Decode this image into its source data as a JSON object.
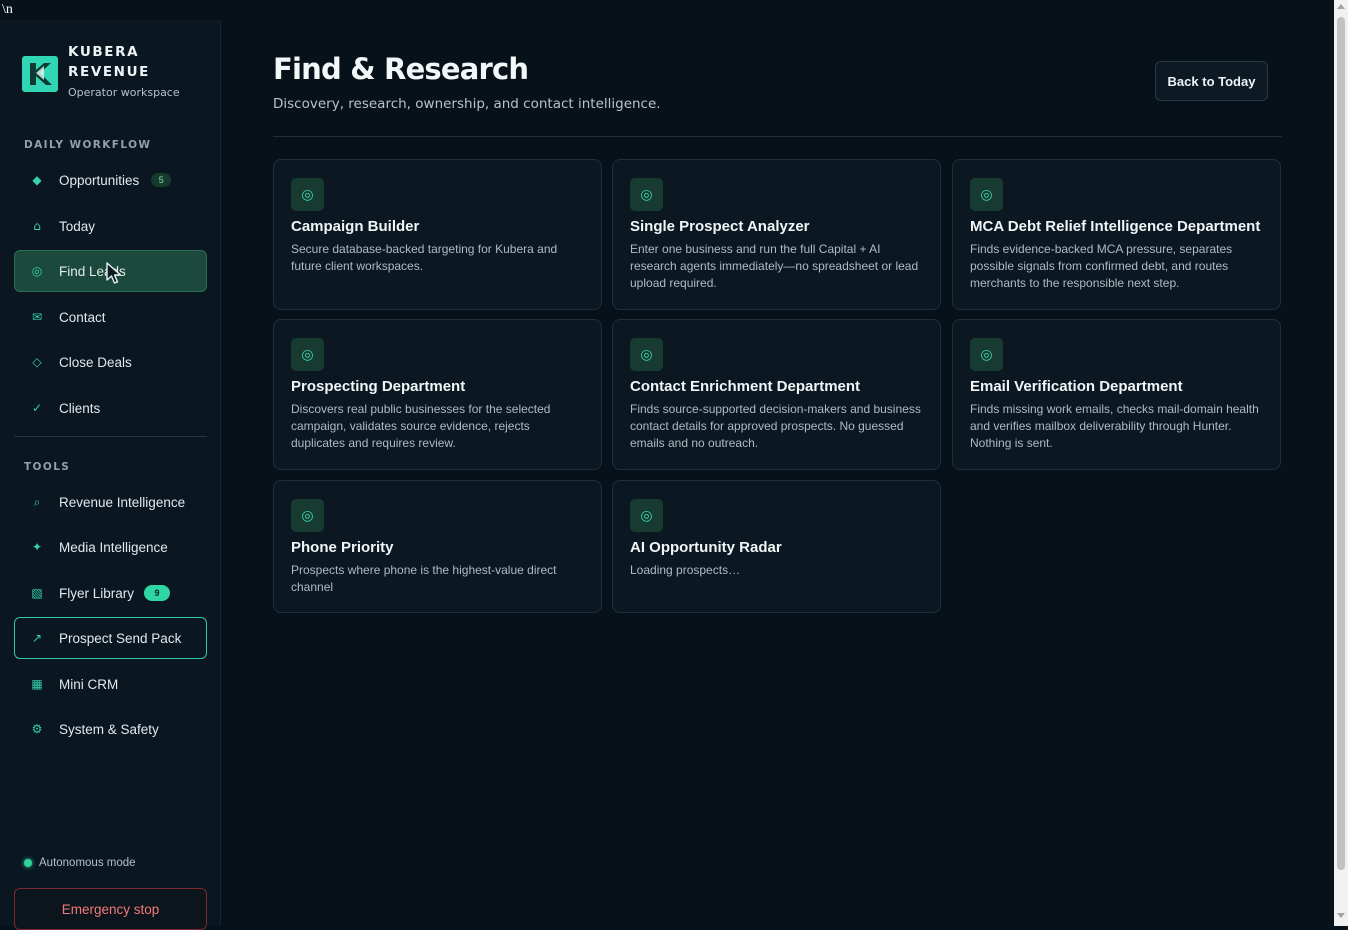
{
  "stray_text": "\\n",
  "brand": {
    "name": "KUBERA REVENUE",
    "subtitle": "Operator workspace",
    "logo_icon": "kubera-logo-icon"
  },
  "sidebar": {
    "daily_label": "DAILY WORKFLOW",
    "daily_items": [
      {
        "label": "Opportunities",
        "icon": "diamond-filled-icon",
        "badge": "5"
      },
      {
        "label": "Today",
        "icon": "home-icon"
      },
      {
        "label": "Find Leads",
        "icon": "target-icon",
        "active": true
      },
      {
        "label": "Contact",
        "icon": "mail-icon"
      },
      {
        "label": "Close Deals",
        "icon": "diamond-outline-icon"
      },
      {
        "label": "Clients",
        "icon": "check-icon"
      }
    ],
    "tools_label": "TOOLS",
    "tool_items": [
      {
        "label": "Revenue Intelligence",
        "icon": "search-icon"
      },
      {
        "label": "Media Intelligence",
        "icon": "sparkle-icon"
      },
      {
        "label": "Flyer Library",
        "icon": "image-icon",
        "badge": "9"
      },
      {
        "label": "Prospect Send Pack",
        "icon": "arrow-up-right-icon",
        "outlined": true
      },
      {
        "label": "Mini CRM",
        "icon": "grid-icon"
      },
      {
        "label": "System & Safety",
        "icon": "gear-icon"
      }
    ],
    "autonomous_label": "Autonomous mode",
    "emergency_label": "Emergency stop"
  },
  "header": {
    "title": "Find & Research",
    "subtitle": "Discovery, research, ownership, and contact intelligence.",
    "back_label": "Back to Today"
  },
  "cards": [
    {
      "title": "Campaign Builder",
      "desc": "Secure database-backed targeting for Kubera and future client workspaces."
    },
    {
      "title": "Single Prospect Analyzer",
      "desc": "Enter one business and run the full Capital + AI research agents immediately—no spreadsheet or lead upload required."
    },
    {
      "title": "MCA Debt Relief Intelligence Department",
      "desc": "Finds evidence-backed MCA pressure, separates possible signals from confirmed debt, and routes merchants to the responsible next step."
    },
    {
      "title": "Prospecting Department",
      "desc": "Discovers real public businesses for the selected campaign, validates source evidence, rejects duplicates and requires review."
    },
    {
      "title": "Contact Enrichment Department",
      "desc": "Finds source-supported decision-makers and business contact details for approved prospects. No guessed emails and no outreach."
    },
    {
      "title": "Email Verification Department",
      "desc": "Finds missing work emails, checks mail-domain health and verifies mailbox deliverability through Hunter. Nothing is sent."
    },
    {
      "title": "Phone Priority",
      "desc": "Prospects where phone is the highest-value direct channel"
    },
    {
      "title": "AI Opportunity Radar",
      "desc": "Loading prospects…"
    }
  ],
  "card_icon": "target-icon",
  "colors": {
    "accent": "#31d6b4",
    "background": "#07111a",
    "sidebar": "#0a1620",
    "danger": "#f07a7a"
  }
}
